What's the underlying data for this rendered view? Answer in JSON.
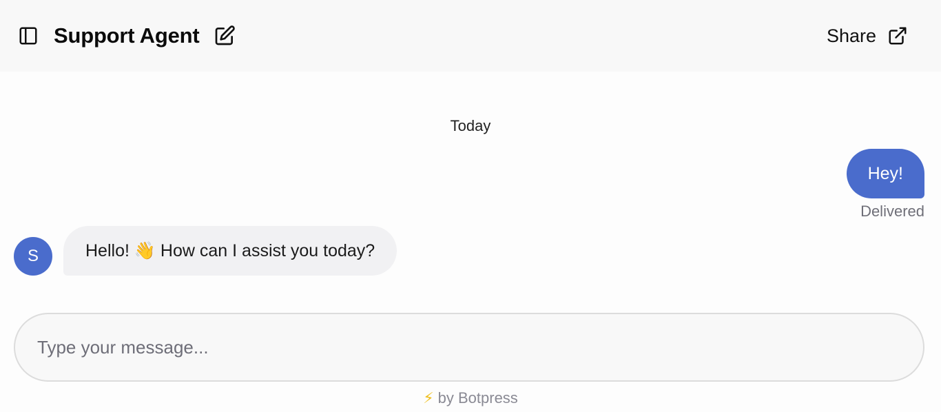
{
  "header": {
    "title": "Support Agent",
    "sidebar_icon": "sidebar-panel-icon",
    "edit_icon": "edit-icon",
    "share_label": "Share",
    "share_icon": "external-link-icon"
  },
  "conversation": {
    "date_separator": "Today",
    "messages": [
      {
        "sender": "user",
        "text": "Hey!",
        "status": "Delivered"
      },
      {
        "sender": "bot",
        "avatar_letter": "S",
        "text": "Hello! 👋 How can I assist you today?"
      }
    ]
  },
  "composer": {
    "placeholder": "Type your message...",
    "value": ""
  },
  "footer": {
    "bolt_icon": "⚡",
    "text": "by Botpress"
  },
  "colors": {
    "accent": "#4a6ccc",
    "bot_bubble": "#f1f1f3",
    "header_bg": "#f8f8f8"
  }
}
